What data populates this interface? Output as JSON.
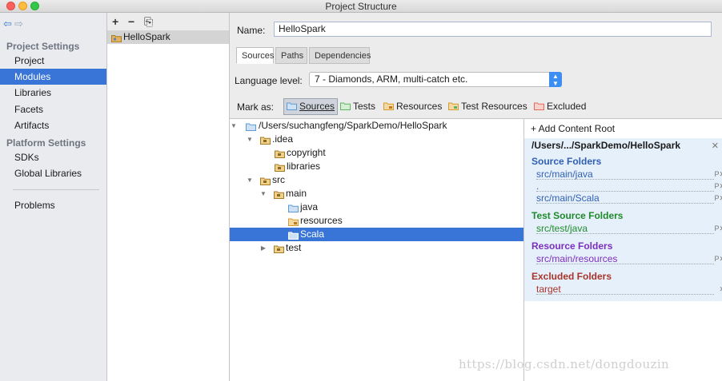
{
  "window": {
    "title": "Project Structure"
  },
  "sidebar": {
    "project_settings_header": "Project Settings",
    "project_items": [
      {
        "label": "Project"
      },
      {
        "label": "Modules",
        "selected": true
      },
      {
        "label": "Libraries"
      },
      {
        "label": "Facets"
      },
      {
        "label": "Artifacts"
      }
    ],
    "platform_settings_header": "Platform Settings",
    "platform_items": [
      {
        "label": "SDKs"
      },
      {
        "label": "Global Libraries"
      }
    ],
    "problems": "Problems"
  },
  "module_list": {
    "toolbar": {
      "add": "+",
      "remove": "−",
      "copy": "⎘"
    },
    "modules": [
      {
        "label": "HelloSpark"
      }
    ]
  },
  "main": {
    "name_label": "Name:",
    "name_value": "HelloSpark",
    "tabs": [
      {
        "label": "Sources",
        "active": true
      },
      {
        "label": "Paths"
      },
      {
        "label": "Dependencies"
      }
    ],
    "language_level_label": "Language level:",
    "language_level_value": "7 - Diamonds, ARM, multi-catch etc.",
    "mark_as_label": "Mark as:",
    "mark_as_buttons": [
      {
        "label": "Sources",
        "color": "#5b9bd5"
      },
      {
        "label": "Tests",
        "color": "#5fb55f"
      },
      {
        "label": "Resources",
        "color": "#d99a2b"
      },
      {
        "label": "Test Resources",
        "color": "#d99a2b"
      },
      {
        "label": "Excluded",
        "color": "#e06b5b"
      }
    ]
  },
  "tree": {
    "rows": [
      {
        "label": "/Users/suchangfeng/SparkDemo/HelloSpark",
        "expand": "▼"
      },
      {
        "label": ".idea",
        "expand": "▼"
      },
      {
        "label": "copyright"
      },
      {
        "label": "libraries"
      },
      {
        "label": "src",
        "expand": "▼"
      },
      {
        "label": "main",
        "expand": "▼"
      },
      {
        "label": "java"
      },
      {
        "label": "resources"
      },
      {
        "label": "Scala",
        "selected": true
      },
      {
        "label": "test",
        "expand": "▶"
      }
    ]
  },
  "content_root": {
    "add_label": "+ Add Content Root",
    "path": "/Users/.../SparkDemo/HelloSpark",
    "source_folders_title": "Source Folders",
    "source_folders": [
      "src/main/java",
      ".",
      "src/main/Scala"
    ],
    "test_source_folders_title": "Test Source Folders",
    "test_source_folders": [
      "src/test/java"
    ],
    "resource_folders_title": "Resource Folders",
    "resource_folders": [
      "src/main/resources"
    ],
    "excluded_folders_title": "Excluded Folders",
    "excluded_folders": [
      "target"
    ],
    "colors": {
      "source": "#2f5fb3",
      "test": "#1e8a2a",
      "resource": "#7b2fc0",
      "excluded": "#a8342a"
    }
  },
  "watermark": "https://blog.csdn.net/dongdouzin"
}
